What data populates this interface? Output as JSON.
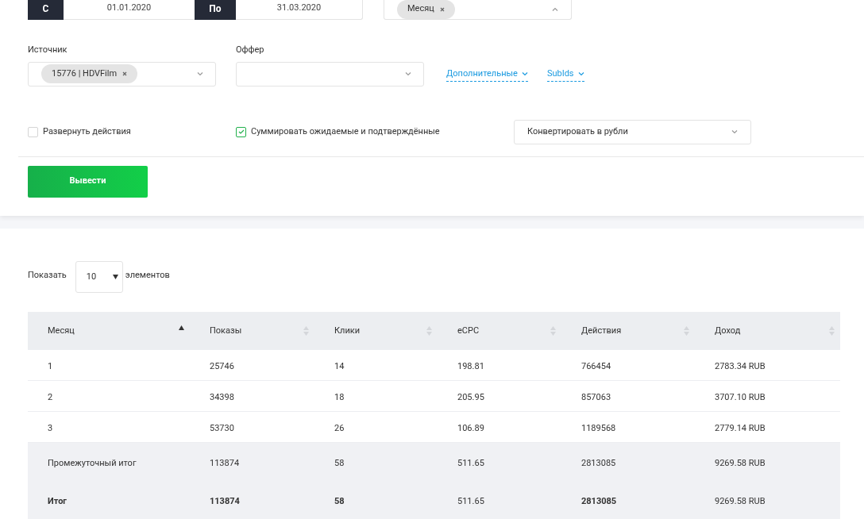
{
  "period": {
    "from_label": "С",
    "from_value": "01.01.2020",
    "to_label": "По",
    "to_value": "31.03.2020"
  },
  "grouping": {
    "tags": [
      "Месяц"
    ],
    "expanded": true
  },
  "source": {
    "label": "Источник",
    "tags": [
      "15776 | HDVFilm"
    ]
  },
  "offer": {
    "label": "Оффер"
  },
  "links": [
    "Дополнительные",
    "SubIds"
  ],
  "options": [
    {
      "label": "Развернуть действия",
      "checked": false
    },
    {
      "label": "Суммировать ожидаемые и подтверждённые",
      "checked": true
    }
  ],
  "currency_select": {
    "value": "Конвертировать в рубли"
  },
  "submit_button": "Вывести",
  "page_size": {
    "before": "Показать",
    "value": "10",
    "after": "элементов"
  },
  "table": {
    "columns": [
      {
        "label": "Месяц",
        "sorted": true
      },
      {
        "label": "Показы",
        "sorted": false
      },
      {
        "label": "Клики",
        "sorted": false
      },
      {
        "label": "eCPC",
        "sorted": false
      },
      {
        "label": "Действия",
        "sorted": false
      },
      {
        "label": "Доход",
        "sorted": false
      }
    ],
    "rows": [
      {
        "kind": "data",
        "cells": [
          {
            "text": "1",
            "bold": false
          },
          {
            "text": "25746",
            "bold": false
          },
          {
            "text": "14",
            "bold": false
          },
          {
            "text": "198.81",
            "bold": false
          },
          {
            "text": "766454",
            "bold": false
          },
          {
            "text": "2783.34 RUB",
            "bold": false
          }
        ]
      },
      {
        "kind": "data",
        "cells": [
          {
            "text": "2",
            "bold": false
          },
          {
            "text": "34398",
            "bold": false
          },
          {
            "text": "18",
            "bold": false
          },
          {
            "text": "205.95",
            "bold": false
          },
          {
            "text": "857063",
            "bold": false
          },
          {
            "text": "3707.10 RUB",
            "bold": false
          }
        ]
      },
      {
        "kind": "data",
        "cells": [
          {
            "text": "3",
            "bold": false
          },
          {
            "text": "53730",
            "bold": false
          },
          {
            "text": "26",
            "bold": false
          },
          {
            "text": "106.89",
            "bold": false
          },
          {
            "text": "1189568",
            "bold": false
          },
          {
            "text": "2779.14 RUB",
            "bold": false
          }
        ]
      },
      {
        "kind": "subtotal",
        "cells": [
          {
            "text": "Промежуточный итог",
            "bold": false
          },
          {
            "text": "113874",
            "bold": false
          },
          {
            "text": "58",
            "bold": false
          },
          {
            "text": "511.65",
            "bold": false
          },
          {
            "text": "2813085",
            "bold": false
          },
          {
            "text": "9269.58 RUB",
            "bold": false
          }
        ]
      },
      {
        "kind": "total",
        "cells": [
          {
            "text": "Итог",
            "bold": true
          },
          {
            "text": "113874",
            "bold": true
          },
          {
            "text": "58",
            "bold": true
          },
          {
            "text": "511.65",
            "bold": false
          },
          {
            "text": "2813085",
            "bold": true
          },
          {
            "text": "9269.58 RUB",
            "bold": false
          }
        ]
      }
    ]
  }
}
